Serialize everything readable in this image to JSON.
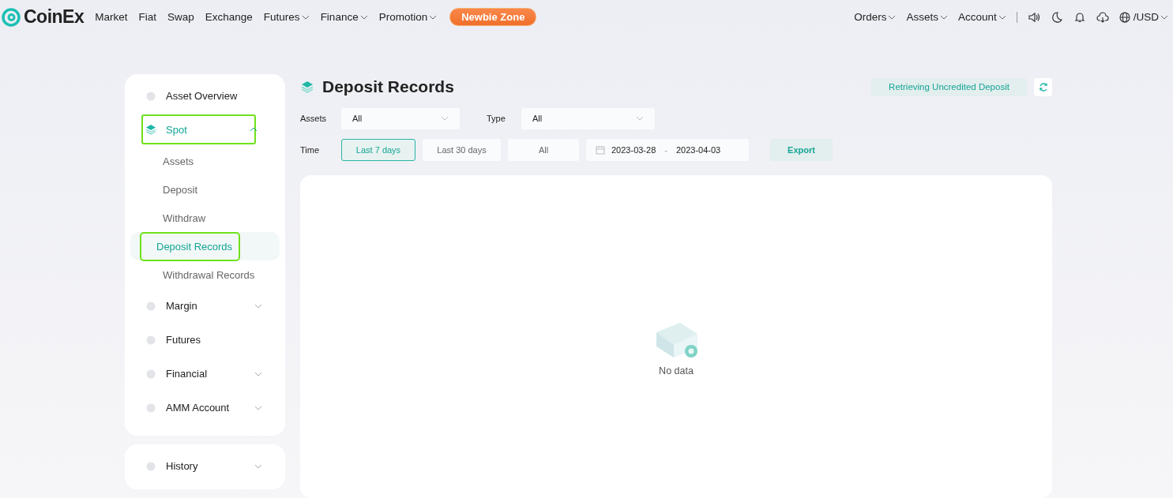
{
  "header": {
    "logo": "CoinEx",
    "nav": [
      {
        "label": "Market",
        "dropdown": false
      },
      {
        "label": "Fiat",
        "dropdown": false
      },
      {
        "label": "Swap",
        "dropdown": false
      },
      {
        "label": "Exchange",
        "dropdown": false
      },
      {
        "label": "Futures",
        "dropdown": true
      },
      {
        "label": "Finance",
        "dropdown": true
      },
      {
        "label": "Promotion",
        "dropdown": true
      }
    ],
    "promo_button": "Newbie Zone",
    "right_menu": [
      {
        "label": "Orders",
        "dropdown": true
      },
      {
        "label": "Assets",
        "dropdown": true
      },
      {
        "label": "Account",
        "dropdown": true
      }
    ],
    "currency": "/USD"
  },
  "sidebar": {
    "groups": [
      {
        "items": [
          {
            "label": "Asset Overview",
            "expandable": false,
            "expanded": false,
            "selected": false,
            "highlighted": false
          },
          {
            "label": "Spot",
            "expandable": true,
            "expanded": true,
            "selected": true,
            "highlighted": true,
            "children": [
              {
                "label": "Assets",
                "selected": false,
                "highlighted": false
              },
              {
                "label": "Deposit",
                "selected": false,
                "highlighted": false
              },
              {
                "label": "Withdraw",
                "selected": false,
                "highlighted": false
              },
              {
                "label": "Deposit Records",
                "selected": true,
                "highlighted": true
              },
              {
                "label": "Withdrawal Records",
                "selected": false,
                "highlighted": false
              }
            ]
          },
          {
            "label": "Margin",
            "expandable": true,
            "expanded": false,
            "selected": false,
            "highlighted": false
          },
          {
            "label": "Futures",
            "expandable": false,
            "expanded": false,
            "selected": false,
            "highlighted": false
          },
          {
            "label": "Financial",
            "expandable": true,
            "expanded": false,
            "selected": false,
            "highlighted": false
          },
          {
            "label": "AMM Account",
            "expandable": true,
            "expanded": false,
            "selected": false,
            "highlighted": false
          }
        ]
      },
      {
        "items": [
          {
            "label": "History",
            "expandable": true,
            "expanded": false,
            "selected": false,
            "highlighted": false
          }
        ]
      }
    ]
  },
  "main": {
    "title": "Deposit Records",
    "retrieve_button": "Retrieving Uncredited Deposit",
    "filters": [
      {
        "label": "Assets",
        "value": "All"
      },
      {
        "label": "Type",
        "value": "All"
      }
    ],
    "time": {
      "label": "Time",
      "options": [
        {
          "label": "Last 7 days",
          "selected": true
        },
        {
          "label": "Last 30 days",
          "selected": false
        },
        {
          "label": "All",
          "selected": false
        }
      ],
      "start": "2023-03-28",
      "separator": "-",
      "end": "2023-04-03"
    },
    "export_button": "Export",
    "empty_text": "No data"
  }
}
